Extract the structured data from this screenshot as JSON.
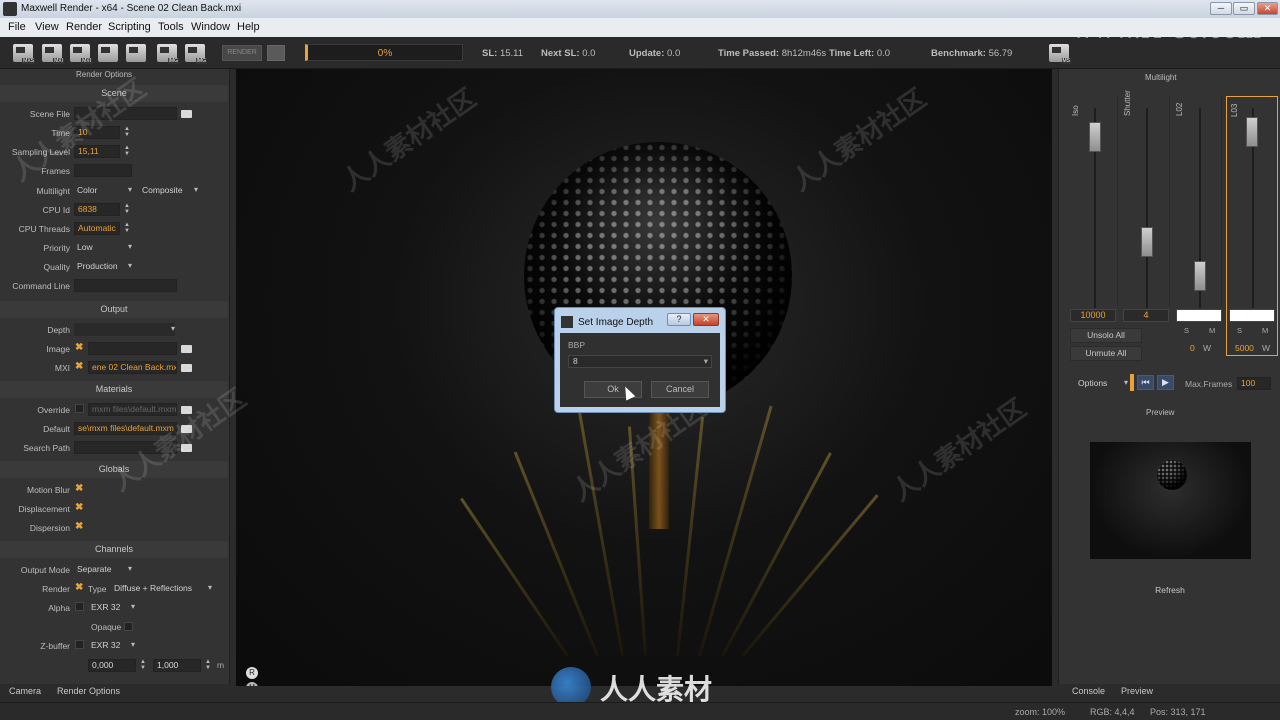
{
  "window": {
    "title": "Maxwell Render  -  x64 - Scene 02 Clean Back.mxi",
    "min": "─",
    "max": "▭",
    "close": "✕"
  },
  "menu": [
    "File",
    "View",
    "Render",
    "Scripting",
    "Tools",
    "Window",
    "Help"
  ],
  "toolbar": {
    "icons": [
      "MXS",
      "MXI",
      "MXI",
      "",
      "",
      "IMG",
      "IMG"
    ],
    "render_label": "RENDER",
    "progress_percent": 0,
    "progress_label": "0%",
    "stats": [
      {
        "label": "SL:",
        "value": "15.11"
      },
      {
        "label": "Next SL:",
        "value": "0.0"
      },
      {
        "label": "Update:",
        "value": "0.0"
      },
      {
        "label": "Time Passed:",
        "value": "8h12m46s"
      },
      {
        "label": "Time Left:",
        "value": "0.0"
      },
      {
        "label": "Benchmark:",
        "value": "56.79"
      }
    ],
    "ms_icon": "MS"
  },
  "left_panel": {
    "title": "Render Options",
    "sections": {
      "scene": "Scene",
      "output": "Output",
      "materials": "Materials",
      "globals": "Globals",
      "channels": "Channels"
    },
    "scene": {
      "scene_file_label": "Scene File",
      "scene_file_value": "",
      "time_label": "Time",
      "time_value": "10",
      "sampling_label": "Sampling Level",
      "sampling_value": "15,11",
      "frames_label": "Frames",
      "frames_value": "",
      "multilight_label": "Multilight",
      "multilight_value": "Color",
      "multilight_mode": "Composite",
      "cpu_id_label": "CPU Id",
      "cpu_id_value": "6838",
      "cpu_threads_label": "CPU Threads",
      "cpu_threads_value": "Automatic",
      "priority_label": "Priority",
      "priority_value": "Low",
      "quality_label": "Quality",
      "quality_value": "Production",
      "command_line_label": "Command Line",
      "command_line_value": ""
    },
    "output": {
      "depth_label": "Depth",
      "depth_value": "",
      "image_label": "Image",
      "image_value": "",
      "mxi_label": "MXI",
      "mxi_value": "ene 02 Clean Back.mxi"
    },
    "materials": {
      "override_label": "Override",
      "override_value": "mxm files\\default.mxm",
      "default_label": "Default",
      "default_value": "se\\mxm files\\default.mxm",
      "search_path_label": "Search Path",
      "search_path_value": ""
    },
    "globals": {
      "motion_blur": "Motion Blur",
      "displacement": "Displacement",
      "dispersion": "Dispersion"
    },
    "channels": {
      "output_mode_label": "Output Mode",
      "output_mode_value": "Separate",
      "render_label": "Render",
      "type_label": "Type",
      "type_value": "Diffuse + Reflections",
      "alpha_label": "Alpha",
      "alpha_value": "EXR 32",
      "opaque_label": "Opaque",
      "zbuffer_label": "Z-buffer",
      "zbuffer_value": "EXR 32",
      "zmin": "0,000",
      "zmax": "1,000",
      "zunit": "m"
    },
    "tabs": [
      "Camera",
      "Render Options"
    ]
  },
  "viewport": {
    "r_badge": "R",
    "m_badge": "M"
  },
  "dialog": {
    "title": "Set Image Depth",
    "help": "?",
    "close": "✕",
    "field_label": "BBP",
    "field_value": "8",
    "ok": "Ok",
    "cancel": "Cancel"
  },
  "right_panel": {
    "multilight_title": "Multilight",
    "columns": [
      {
        "name": "Iso",
        "value": "10000",
        "level": 0.92
      },
      {
        "name": "Shutter",
        "value": "4",
        "level": 0.3
      },
      {
        "name": "L02",
        "value": "",
        "level": 0.1
      },
      {
        "name": "L03",
        "value": "",
        "level": 0.95
      }
    ],
    "unsolo_all": "Unsolo All",
    "unmute_all": "Unmute All",
    "s_label": "S",
    "m_label": "M",
    "l02_intensity": "0",
    "l02_unit": "W",
    "l03_intensity": "5000",
    "l03_unit": "W",
    "options_label": "Options",
    "max_frames_label": "Max.Frames",
    "max_frames_value": "100",
    "preview_title": "Preview",
    "refresh": "Refresh",
    "tabs": [
      "Console",
      "Preview"
    ]
  },
  "status": {
    "zoom": "zoom: 100%",
    "rgb": "RGB: 4,4,4",
    "pos": "Pos: 313, 171"
  },
  "watermarks": {
    "url": "www.rr-sc.com",
    "text": "人人素材社区",
    "logo_text": "人人素材"
  },
  "colors": {
    "accent": "#e8a23a",
    "panel": "#333333",
    "viewport": "#0d0d0d",
    "dialog_frame": "#b9d1ea"
  }
}
